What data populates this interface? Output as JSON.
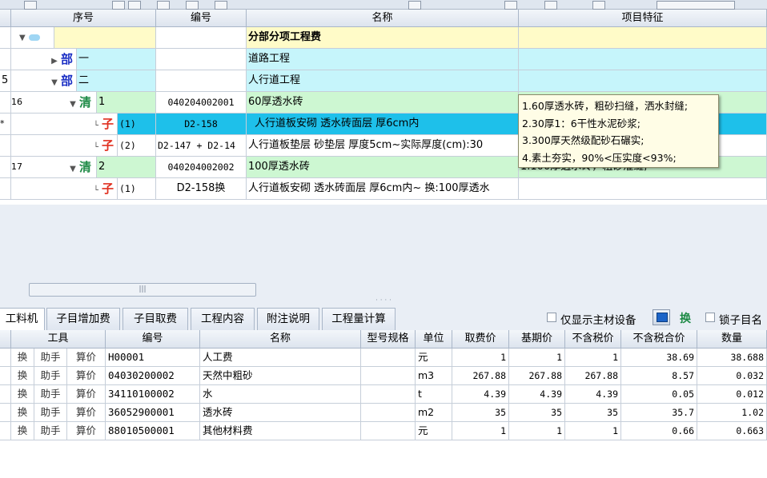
{
  "top_grid": {
    "columns": [
      "序号",
      "编号",
      "名称",
      "项目特征"
    ],
    "rows": [
      {
        "row_no": "",
        "serial": "",
        "code": "",
        "name": "分部分项工程费",
        "feature": ""
      },
      {
        "row_no": "",
        "tag": "部",
        "serial": "一",
        "code": "",
        "name": "道路工程",
        "feature": ""
      },
      {
        "row_no": "5",
        "tag": "部",
        "serial": "二",
        "code": "",
        "name": "人行道工程",
        "feature": ""
      },
      {
        "row_no": "16",
        "tag": "清",
        "serial": "1",
        "code": "040204002001",
        "name": "60厚透水砖",
        "feature": ""
      },
      {
        "row_no": "*",
        "tag": "子",
        "serial": "(1)",
        "code": "D2-158",
        "name": "人行道板安砌 透水砖面层 厚6cm内",
        "feature": ""
      },
      {
        "row_no": "",
        "tag": "子",
        "serial": "(2)",
        "code": "D2-147 + D2-14",
        "name": "人行道板垫层 砂垫层 厚度5cm~实际厚度(cm):30",
        "feature": ""
      },
      {
        "row_no": "17",
        "tag": "清",
        "serial": "2",
        "code": "040204002002",
        "name": "100厚透水砖",
        "feature": "1.100厚透水砖，粗砂灌缝;"
      },
      {
        "row_no": "",
        "tag": "子",
        "serial": "(1)",
        "code": "D2-158换",
        "name": "人行道板安砌 透水砖面层 厚6cm内~ 换:100厚透水",
        "feature": ""
      }
    ],
    "tooltip_lines": [
      "1.60厚透水砖，粗砂扫缝，洒水封缝;",
      "2.30厚1：6干性水泥砂浆;",
      "3.300厚天然级配砂石碾实;",
      "4.素土夯实，90%<压实度<93%;"
    ]
  },
  "tabs": [
    "工料机",
    "子目增加费",
    "子目取费",
    "工程内容",
    "附注说明",
    "工程量计算"
  ],
  "active_tab": 0,
  "options": {
    "main_material_label": "仅显示主材设备",
    "swap_label": "换",
    "lock_label": "锁子目名"
  },
  "bottom_grid": {
    "columns": [
      "工具",
      "编号",
      "名称",
      "型号规格",
      "单位",
      "取费价",
      "基期价",
      "不含税价",
      "不含税合价",
      "数量"
    ],
    "tools": [
      "换",
      "助手",
      "算价"
    ],
    "rows": [
      {
        "code": "H00001",
        "name": "人工费",
        "spec": "",
        "unit": "元",
        "fee_price": "1",
        "base_price": "1",
        "ex_tax_price": "1",
        "ex_tax_total": "38.69",
        "qty": "38.688"
      },
      {
        "code": "04030200002",
        "name": "天然中粗砂",
        "spec": "",
        "unit": "m3",
        "fee_price": "267.88",
        "base_price": "267.88",
        "ex_tax_price": "267.88",
        "ex_tax_total": "8.57",
        "qty": "0.032"
      },
      {
        "code": "34110100002",
        "name": "水",
        "spec": "",
        "unit": "t",
        "fee_price": "4.39",
        "base_price": "4.39",
        "ex_tax_price": "4.39",
        "ex_tax_total": "0.05",
        "qty": "0.012"
      },
      {
        "code": "36052900001",
        "name": "透水砖",
        "spec": "",
        "unit": "m2",
        "fee_price": "35",
        "base_price": "35",
        "ex_tax_price": "35",
        "ex_tax_total": "35.7",
        "qty": "1.02"
      },
      {
        "code": "88010500001",
        "name": "其他材料费",
        "spec": "",
        "unit": "元",
        "fee_price": "1",
        "base_price": "1",
        "ex_tax_price": "1",
        "ex_tax_total": "0.66",
        "qty": "0.663"
      }
    ]
  },
  "colors": {
    "selected_row": "#1ec0ea",
    "division_row": "#c6f5fb",
    "list_row": "#cdf7d2",
    "header_row": "#fffbc8"
  }
}
